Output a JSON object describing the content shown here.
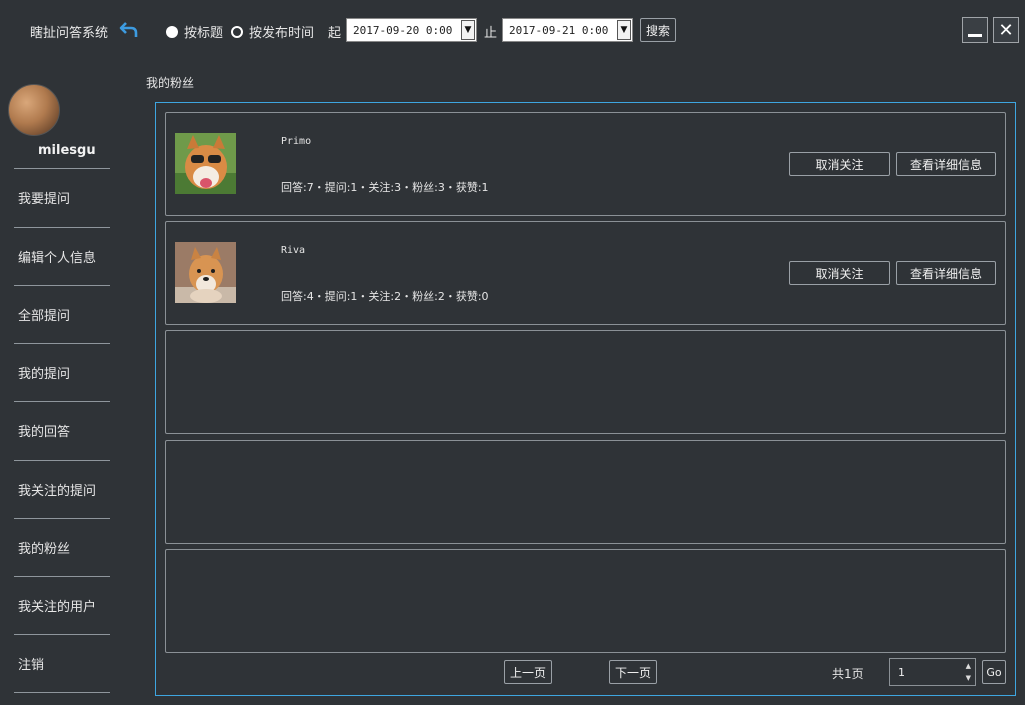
{
  "header": {
    "app_title": "瞎扯问答系统",
    "radio_title": "按标题",
    "radio_time": "按发布时间",
    "from_label": "起",
    "from_value": "2017-09-20 0:00",
    "to_label": "止",
    "to_value": "2017-09-21 0:00",
    "search_label": "搜索",
    "minimize_icon": "minimize-icon",
    "close_icon": "close-icon"
  },
  "user": {
    "name": "milesgu"
  },
  "sidebar": {
    "items": [
      {
        "label": "我要提问"
      },
      {
        "label": "编辑个人信息"
      },
      {
        "label": "全部提问"
      },
      {
        "label": "我的提问"
      },
      {
        "label": "我的回答"
      },
      {
        "label": "我关注的提问"
      },
      {
        "label": "我的粉丝"
      },
      {
        "label": "我关注的用户"
      },
      {
        "label": "注销"
      }
    ]
  },
  "main": {
    "section_title": "我的粉丝",
    "fans": [
      {
        "name": "Primo",
        "stats": "回答:7・提问:1・关注:3・粉丝:3・获赞:1",
        "unfollow": "取消关注",
        "details": "查看详细信息"
      },
      {
        "name": "Riva",
        "stats": "回答:4・提问:1・关注:2・粉丝:2・获赞:0",
        "unfollow": "取消关注",
        "details": "查看详细信息"
      }
    ]
  },
  "pager": {
    "prev": "上一页",
    "next": "下一页",
    "total": "共1页",
    "page_value": "1",
    "go": "Go"
  },
  "colors": {
    "background": "#2f3337",
    "panel_border": "#3ea6e0",
    "accent_back": "#3d9be0"
  }
}
